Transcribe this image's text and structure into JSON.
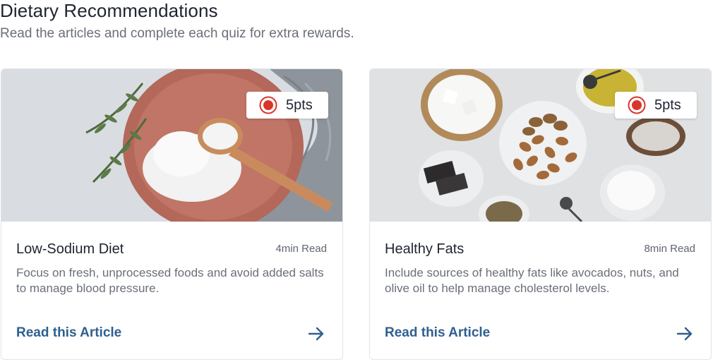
{
  "header": {
    "title": "Dietary Recommendations",
    "subtitle": "Read the articles and complete each quiz for extra rewards."
  },
  "cards": [
    {
      "image_icon": "salt-bowl-spoon-image",
      "points": "5pts",
      "title": "Low-Sodium Diet",
      "read_time": "4min Read",
      "description": "Focus on fresh, unprocessed foods and avoid added salts to manage blood pressure.",
      "link_label": "Read this Article"
    },
    {
      "image_icon": "healthy-fats-foods-image",
      "points": "5pts",
      "title": "Healthy Fats",
      "read_time": "8min Read",
      "description": "Include sources of healthy fats like avocados, nuts, and olive oil to help manage cholesterol levels.",
      "link_label": "Read this Article"
    }
  ],
  "colors": {
    "accent": "#2f5f8f",
    "badge_dot": "#d9362b",
    "text_primary": "#1f2430",
    "text_secondary": "#6a6f78"
  }
}
